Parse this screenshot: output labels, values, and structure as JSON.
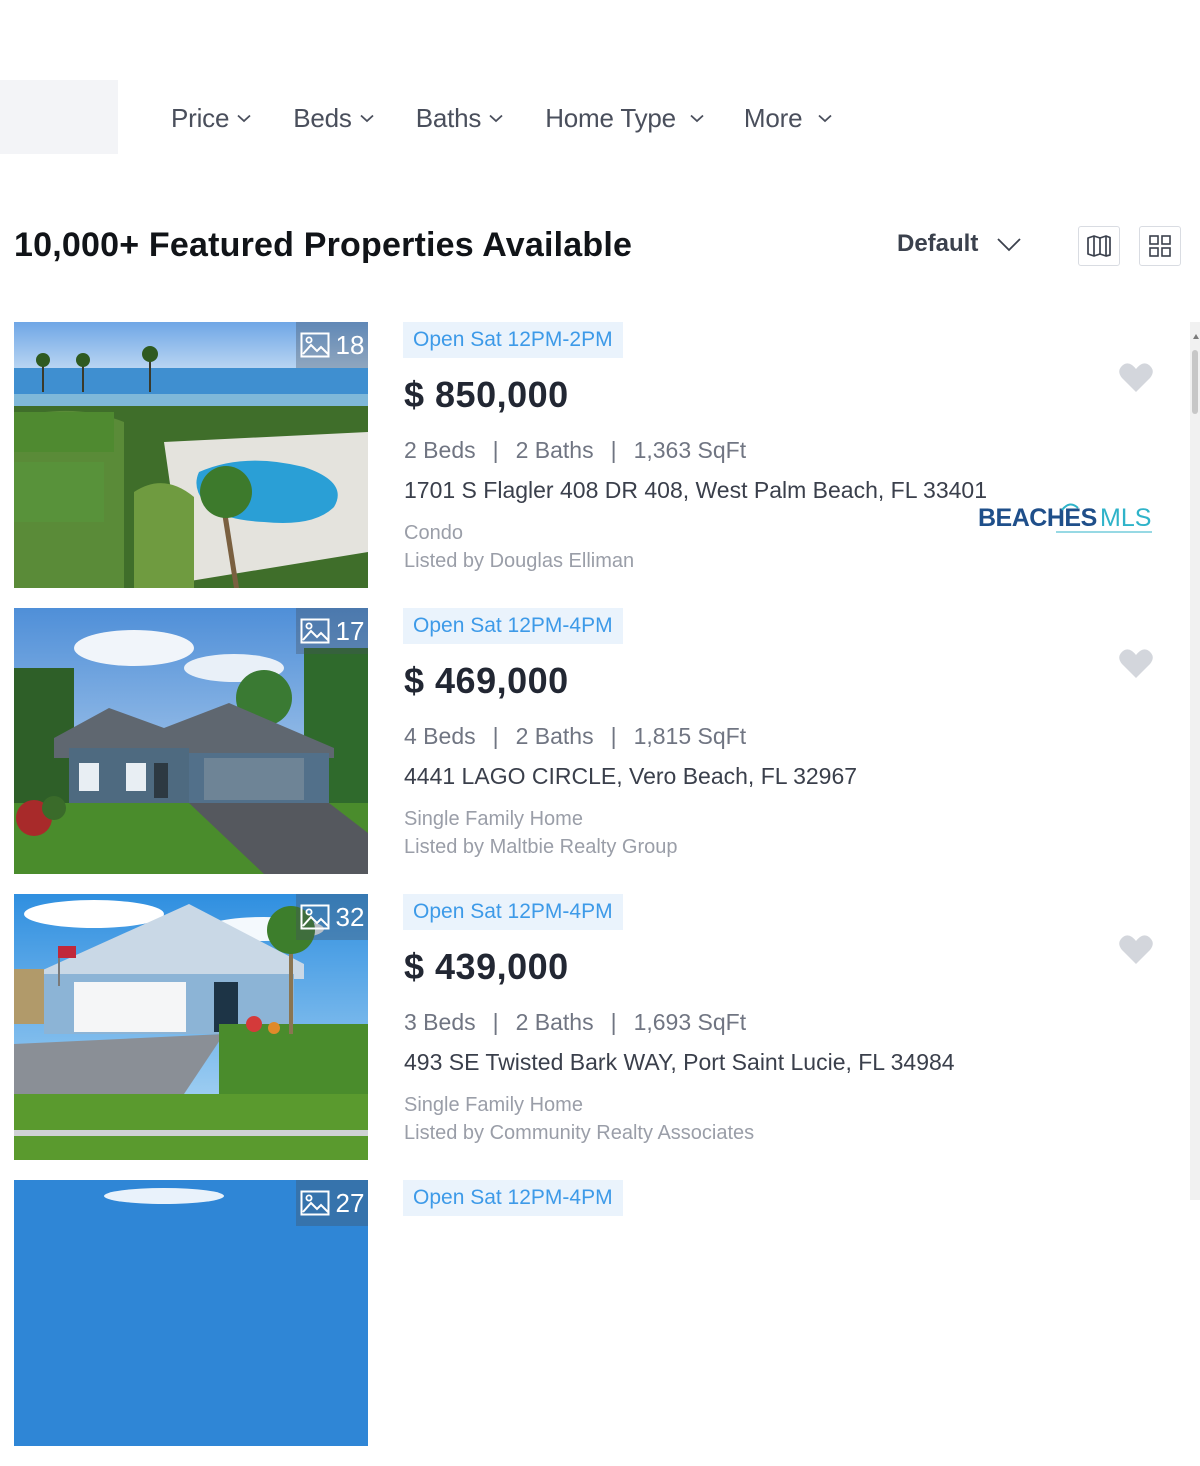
{
  "filters": {
    "price": "Price",
    "beds": "Beds",
    "baths": "Baths",
    "home_type": "Home Type",
    "more": "More"
  },
  "results": {
    "heading": "10,000+ Featured Properties Available",
    "sort_label": "Default"
  },
  "colors": {
    "accent_blue": "#3d9ae8",
    "badge_bg": "#eaf3fc",
    "price_text": "#222733",
    "muted_text": "#9a9ea8",
    "favorite_heart": "#d3d6dc"
  },
  "listings": [
    {
      "photo_count": "18",
      "open_house": "Open Sat 12PM-2PM",
      "price": "$ 850,000",
      "beds": "2 Beds",
      "baths": "2 Baths",
      "sqft": "1,363 SqFt",
      "address": "1701 S Flagler 408 DR 408, West Palm Beach, FL 33401",
      "property_type": "Condo",
      "listed_by": "Listed by Douglas Elliman"
    },
    {
      "photo_count": "17",
      "open_house": "Open Sat 12PM-4PM",
      "price": "$ 469,000",
      "beds": "4 Beds",
      "baths": "2 Baths",
      "sqft": "1,815 SqFt",
      "address": "4441 LAGO CIRCLE, Vero Beach, FL 32967",
      "property_type": "Single Family Home",
      "listed_by": "Listed by Maltbie Realty Group",
      "mls_logo_text": "BEACHES",
      "mls_logo_suffix": "MLS"
    },
    {
      "photo_count": "32",
      "open_house": "Open Sat 12PM-4PM",
      "price": "$ 439,000",
      "beds": "3 Beds",
      "baths": "2 Baths",
      "sqft": "1,693 SqFt",
      "address": "493 SE Twisted Bark WAY, Port Saint Lucie, FL 34984",
      "property_type": "Single Family Home",
      "listed_by": "Listed by Community Realty Associates"
    },
    {
      "photo_count": "27",
      "open_house": "Open Sat 12PM-4PM"
    }
  ]
}
